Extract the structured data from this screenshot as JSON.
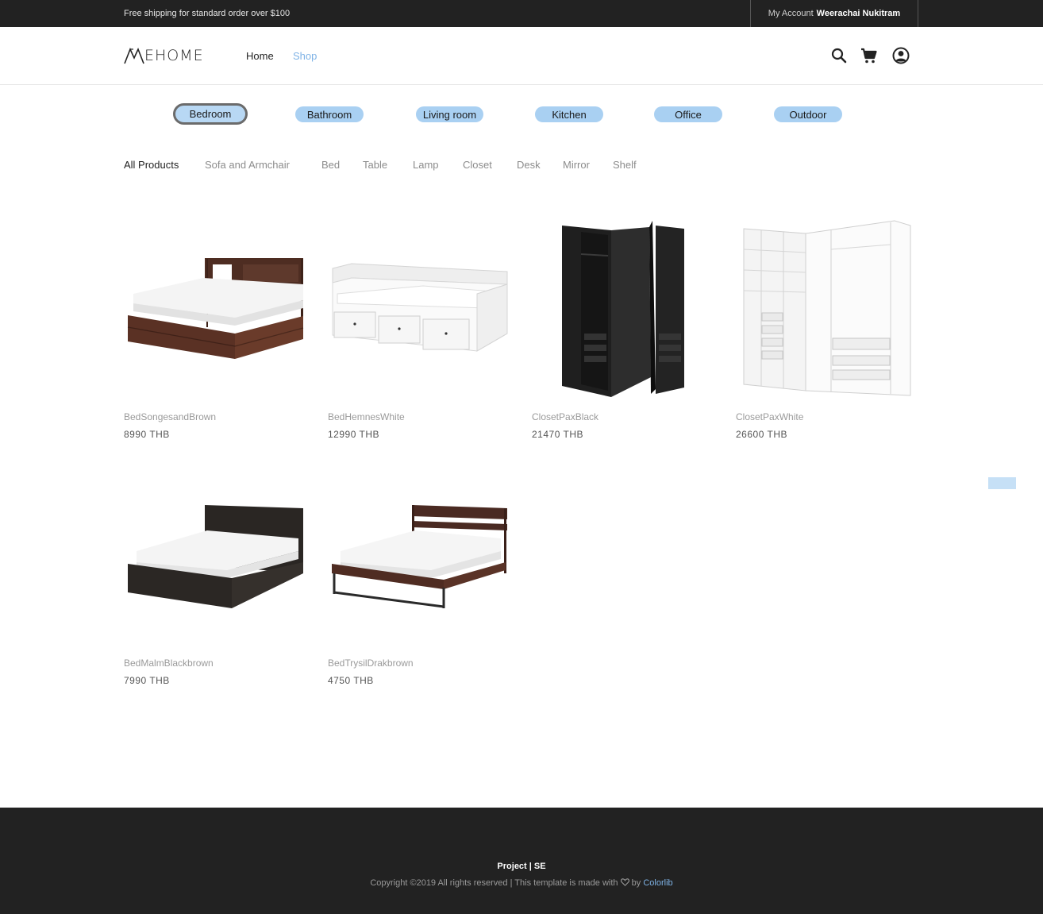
{
  "topbar": {
    "shipping_text": "Free shipping for standard order over $100",
    "account_label": "My Account",
    "account_name": "Weerachai Nukitram"
  },
  "header": {
    "logo_text": "EHOME",
    "nav": [
      {
        "label": "Home"
      },
      {
        "label": "Shop"
      }
    ],
    "icons": [
      "search-icon",
      "cart-icon",
      "account-icon"
    ]
  },
  "rooms": [
    {
      "label": "Bedroom",
      "active": true
    },
    {
      "label": "Bathroom"
    },
    {
      "label": "Living room"
    },
    {
      "label": "Kitchen"
    },
    {
      "label": "Office"
    },
    {
      "label": "Outdoor"
    }
  ],
  "categories": [
    {
      "label": "All Products",
      "active": true
    },
    {
      "label": "Sofa and Armchair"
    },
    {
      "label": "Bed"
    },
    {
      "label": "Table"
    },
    {
      "label": "Lamp"
    },
    {
      "label": "Closet"
    },
    {
      "label": "Desk"
    },
    {
      "label": "Mirror"
    },
    {
      "label": "Shelf"
    }
  ],
  "products": [
    {
      "name": "BedSongesandBrown",
      "price": "8990 THB"
    },
    {
      "name": "BedHemnesWhite",
      "price": "12990 THB"
    },
    {
      "name": "ClosetPaxBlack",
      "price": "21470 THB"
    },
    {
      "name": "ClosetPaxWhite",
      "price": "26600 THB"
    },
    {
      "name": "BedMalmBlackbrown",
      "price": "7990 THB"
    },
    {
      "name": "BedTrysilDrakbrown",
      "price": "4750 THB"
    }
  ],
  "footer": {
    "project": "Project | SE",
    "copyright": "Copyright ©2019 All rights reserved | This template is made with",
    "by": "by",
    "brand": "Colorlib"
  },
  "colors": {
    "accent": "#7fb3e6",
    "pill": "#a9d0f2",
    "dark": "#222222"
  }
}
